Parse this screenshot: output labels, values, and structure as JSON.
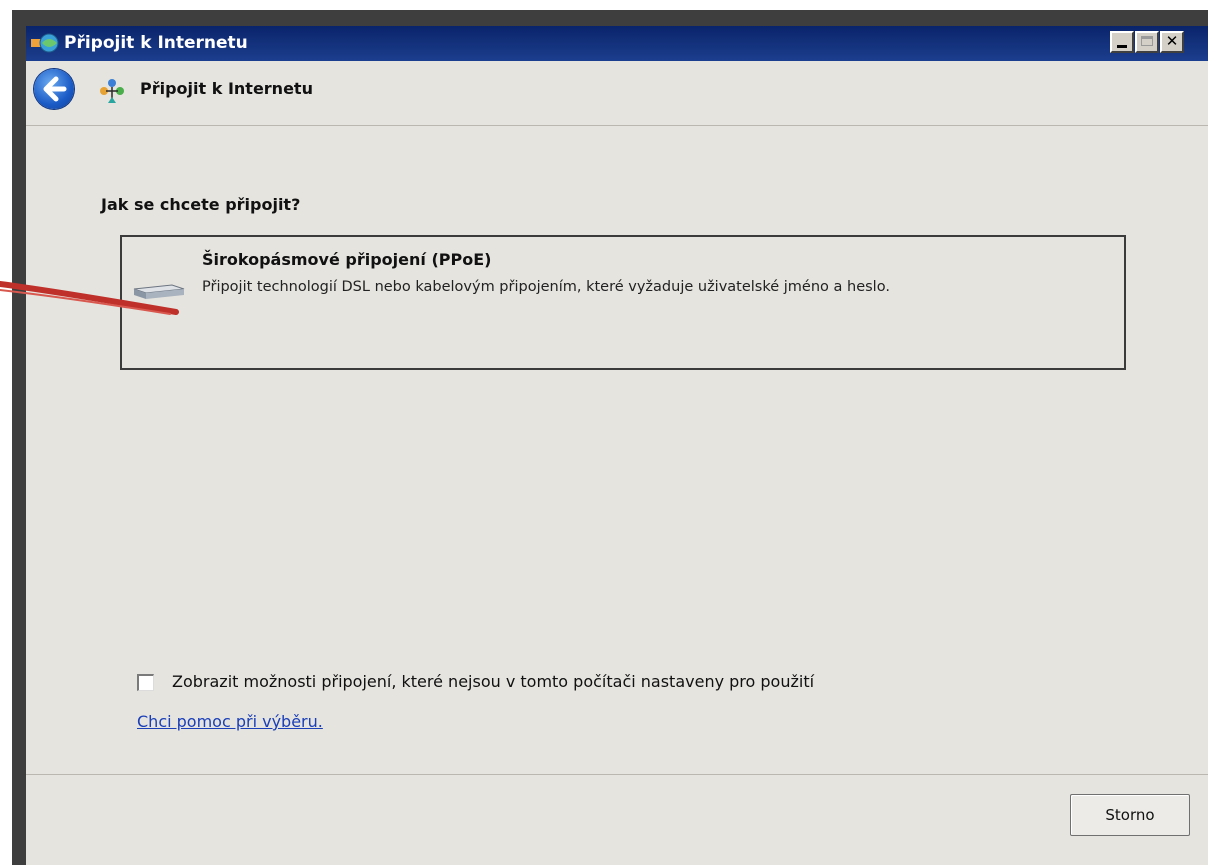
{
  "window": {
    "title": "Připojit k Internetu",
    "controls": {
      "minimize": "",
      "maximize": "",
      "close": "✕"
    }
  },
  "nav": {
    "title": "Připojit k Internetu"
  },
  "main": {
    "question": "Jak se chcete připojit?",
    "option": {
      "title": "Širokopásmové připojení (PPoE)",
      "description": "Připojit technologií DSL nebo kabelovým připojením, které vyžaduje uživatelské jméno a heslo."
    },
    "show_options_checkbox": {
      "label": "Zobrazit možnosti připojení, které nejsou v tomto počítači nastaveny pro použití",
      "checked": false
    },
    "help_link": "Chci pomoc při výběru."
  },
  "footer": {
    "cancel_label": "Storno"
  },
  "icons": {
    "title": "network-globe-icon",
    "back": "back-arrow-icon",
    "wizard": "network-wizard-icon",
    "modem": "broadband-modem-icon"
  },
  "colors": {
    "titlebar": "#0a246a",
    "window_bg": "#e6e4df",
    "link": "#1a3fb8",
    "annotation_arrow": "#c0302a"
  }
}
